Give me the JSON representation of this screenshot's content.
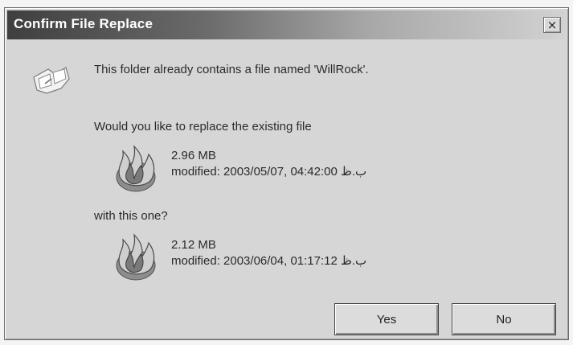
{
  "dialog": {
    "title": "Confirm File Replace",
    "close_label": "×",
    "message": "This folder already contains a file named 'WillRock'.",
    "question": "Would you like to replace the existing file",
    "existing_file": {
      "size": "2.96 MB",
      "modified": "modified: 2003/05/07, 04:42:00 ب.ظ"
    },
    "with_label": "with this one?",
    "new_file": {
      "size": "2.12 MB",
      "modified": "modified: 2003/06/04, 01:17:12 ب.ظ"
    },
    "buttons": {
      "yes": "Yes",
      "no": "No"
    }
  },
  "icons": {
    "dialog_icon": "file-replace-icon",
    "file_icon": "flame-file-icon"
  }
}
